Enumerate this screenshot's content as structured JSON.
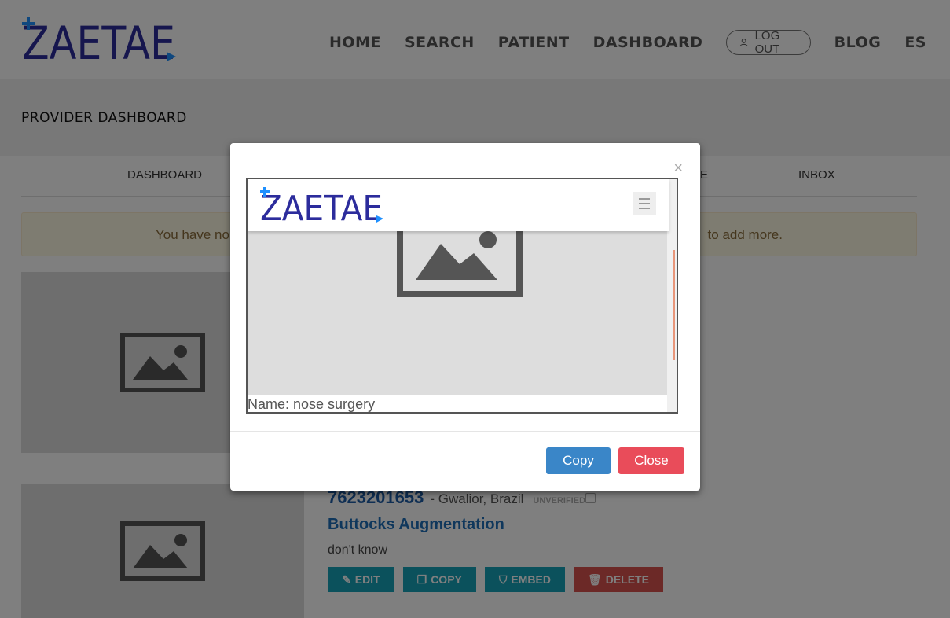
{
  "brand": {
    "logo_text": "ZAETAE",
    "primary_color": "#2c2c9c",
    "accent_color": "#1e90ff"
  },
  "nav": {
    "home": "HOME",
    "search": "SEARCH",
    "patient": "PATIENT",
    "dashboard": "DASHBOARD",
    "logout": "LOG OUT",
    "blog": "BLOG",
    "lang": "ES"
  },
  "page": {
    "title": "PROVIDER DASHBOARD"
  },
  "tabs": {
    "dashboard": "DASHBOARD",
    "partial": "E",
    "inbox": "INBOX"
  },
  "alert": {
    "left_text": "You have no",
    "right_text": "to add more."
  },
  "listing": {
    "id": "7623201653",
    "location": "- Gwalior, Brazil",
    "status": "UNVERIFIED",
    "title": "Buttocks Augmentation",
    "description": "don't know",
    "actions": {
      "edit": "EDIT",
      "copy": "COPY",
      "embed": "EMBED",
      "delete": "DELETE"
    }
  },
  "modal": {
    "close_symbol": "×",
    "embed_preview": {
      "caption": "Name: nose surgery"
    },
    "copy_label": "Copy",
    "close_label": "Close"
  }
}
